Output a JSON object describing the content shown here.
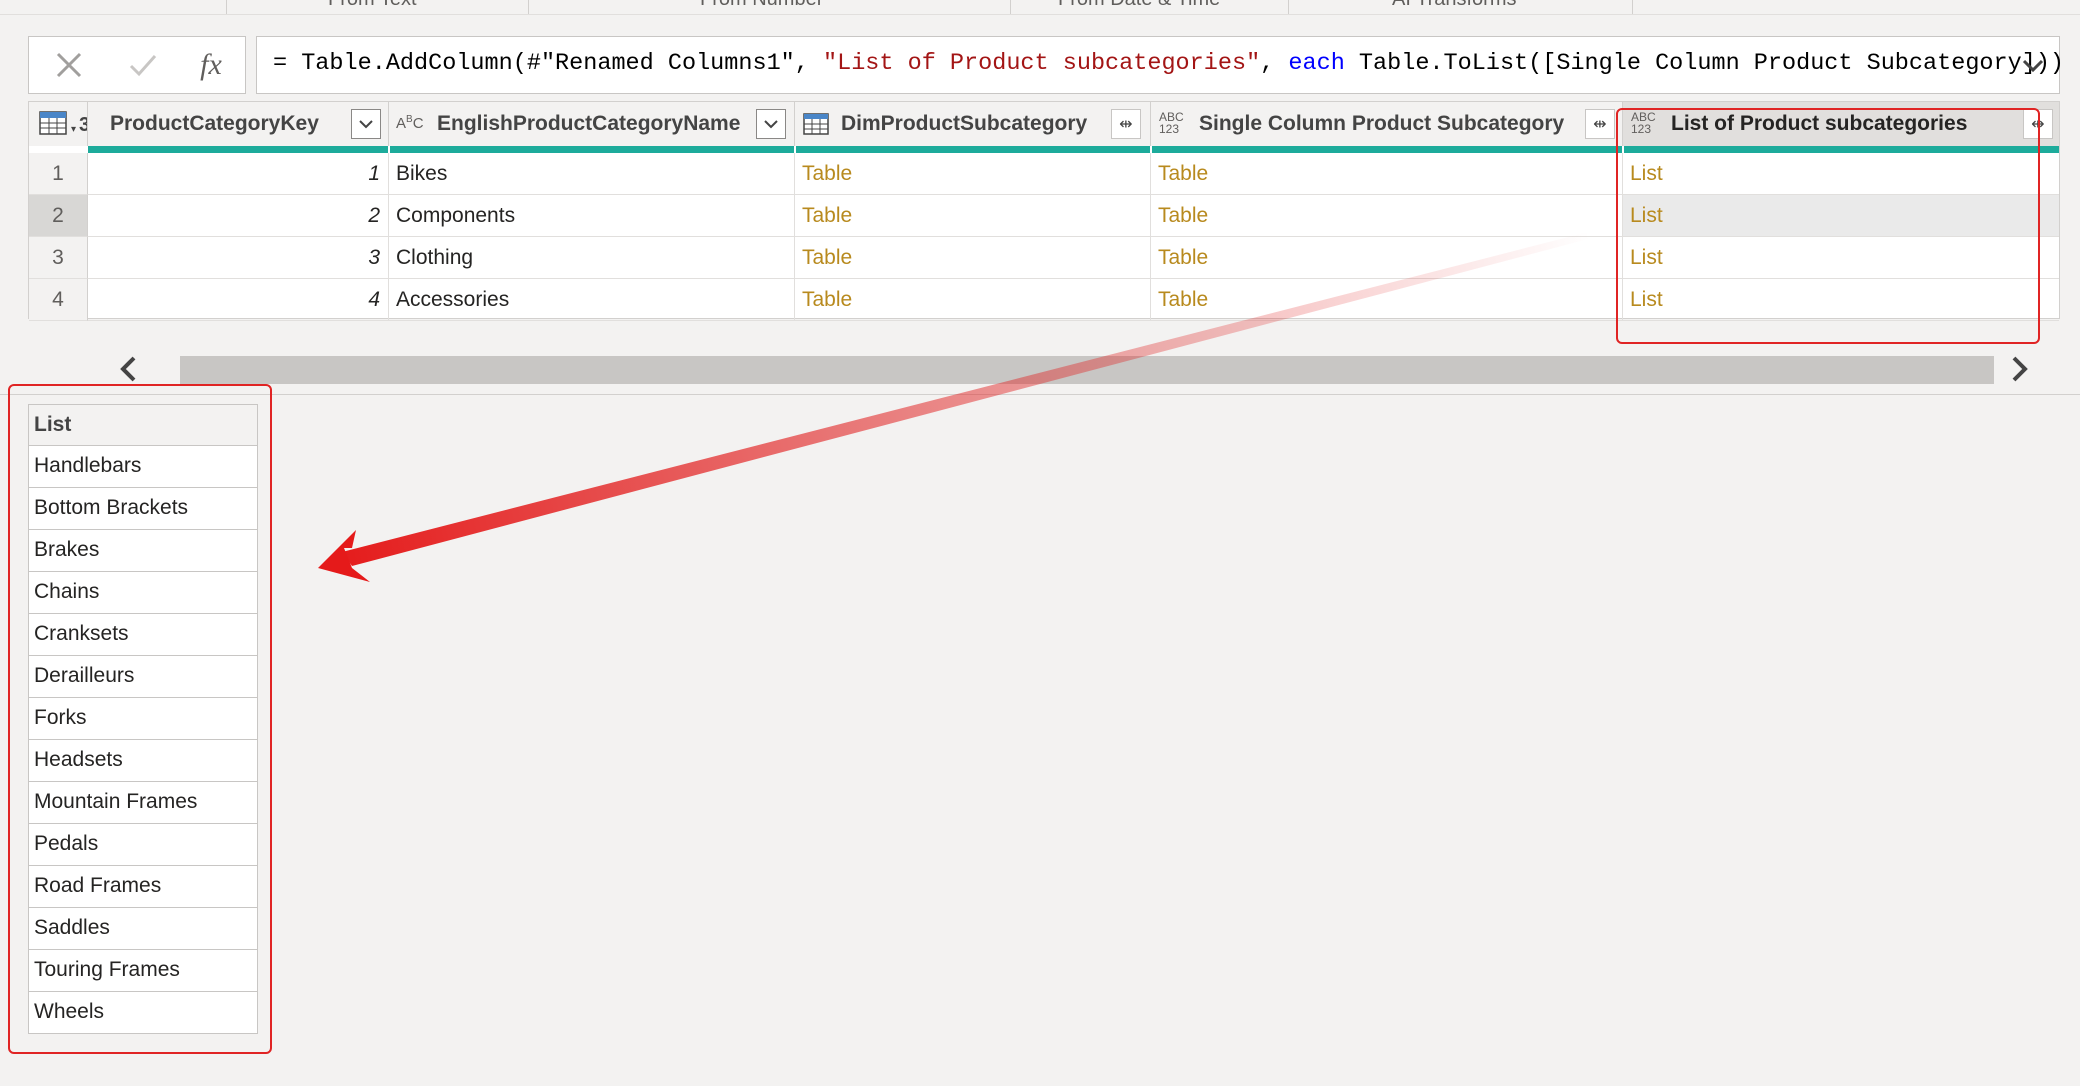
{
  "ribbon": {
    "items": [
      "From Text",
      "From Number",
      "From Date & Time",
      "AI Transforms"
    ]
  },
  "formula_bar": {
    "cancel_icon": "close-icon",
    "commit_icon": "checkmark-icon",
    "fx_label": "fx",
    "formula_prefix": "= Table.AddColumn(#\"Renamed Columns1\", ",
    "formula_string": "\"List of Product subcategories\"",
    "formula_sep": ", ",
    "formula_keyword": "each",
    "formula_suffix": " Table.ToList([Single Column Product Subcategory]))"
  },
  "grid": {
    "corner_type": "3",
    "columns": [
      {
        "label": "ProductCategoryKey",
        "type_icon": "",
        "button": "filter"
      },
      {
        "label": "EnglishProductCategoryName",
        "type_icon": "ABC",
        "button": "filter"
      },
      {
        "label": "DimProductSubcategory",
        "type_icon": "table",
        "button": "expand"
      },
      {
        "label": "Single Column Product Subcategory",
        "type_icon": "ABC123",
        "button": "expand"
      },
      {
        "label": "List of Product subcategories",
        "type_icon": "ABC123",
        "button": "expand"
      }
    ],
    "rows": [
      {
        "n": "1",
        "key": "1",
        "name": "Bikes",
        "sub": "Table",
        "single": "Table",
        "list": "List"
      },
      {
        "n": "2",
        "key": "2",
        "name": "Components",
        "sub": "Table",
        "single": "Table",
        "list": "List"
      },
      {
        "n": "3",
        "key": "3",
        "name": "Clothing",
        "sub": "Table",
        "single": "Table",
        "list": "List"
      },
      {
        "n": "4",
        "key": "4",
        "name": "Accessories",
        "sub": "Table",
        "single": "Table",
        "list": "List"
      }
    ]
  },
  "list_preview": {
    "header": "List",
    "items": [
      "Handlebars",
      "Bottom Brackets",
      "Brakes",
      "Chains",
      "Cranksets",
      "Derailleurs",
      "Forks",
      "Headsets",
      "Mountain Frames",
      "Pedals",
      "Road Frames",
      "Saddles",
      "Touring Frames",
      "Wheels"
    ]
  },
  "colors": {
    "accent_teal": "#1dab9b",
    "link_gold": "#b88a1e",
    "annotation_red": "#e02424"
  }
}
